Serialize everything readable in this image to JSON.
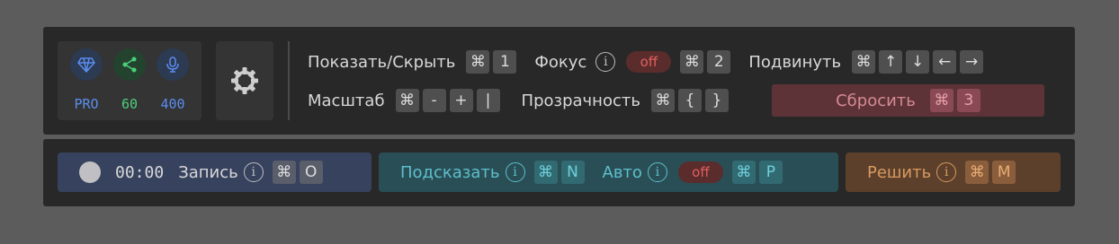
{
  "stats": [
    {
      "icon": "diamond-icon",
      "value": "PRO",
      "color": "#5b8def",
      "bg": "#2c3a52"
    },
    {
      "icon": "share-icon",
      "value": "60",
      "color": "#4ccf7a",
      "bg": "#24432f"
    },
    {
      "icon": "microphone-icon",
      "value": "400",
      "color": "#5b8def",
      "bg": "#2c3a52"
    }
  ],
  "row1": {
    "show_hide": {
      "label": "Показать/Скрыть",
      "keys": [
        "⌘",
        "1"
      ]
    },
    "focus": {
      "label": "Фокус",
      "toggle": "off",
      "keys": [
        "⌘",
        "2"
      ]
    },
    "move": {
      "label": "Подвинуть",
      "keys": [
        "⌘",
        "↑",
        "↓",
        "←",
        "→"
      ]
    }
  },
  "row2": {
    "scale": {
      "label": "Масштаб",
      "keys": [
        "⌘",
        "-",
        "+",
        "|"
      ]
    },
    "opacity": {
      "label": "Прозрачность",
      "keys": [
        "⌘",
        "{",
        "}"
      ]
    },
    "reset": {
      "label": "Сбросить",
      "keys": [
        "⌘",
        "3"
      ]
    }
  },
  "bottom": {
    "record": {
      "timer": "00:00",
      "label": "Запись",
      "keys": [
        "⌘",
        "O"
      ]
    },
    "hint": {
      "label": "Подсказать",
      "keys": [
        "⌘",
        "N"
      ]
    },
    "auto": {
      "label": "Авто",
      "toggle": "off",
      "keys": [
        "⌘",
        "P"
      ]
    },
    "solve": {
      "label": "Решить",
      "keys": [
        "⌘",
        "M"
      ]
    }
  },
  "info_glyph": "i"
}
